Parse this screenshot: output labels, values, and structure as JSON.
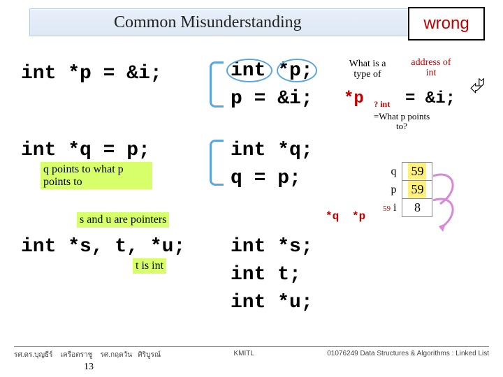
{
  "title": "Common Misunderstanding",
  "wrong_label": "wrong",
  "left": {
    "l1": "int *p = &i;",
    "l2": "int *q = p;",
    "l3": "int *s, t, *u;"
  },
  "right": {
    "r1a": "int *p;",
    "r1b": "p = &i;",
    "r2a": "int *q;",
    "r2b": "q = p;",
    "r3a": "int *s;",
    "r3b": "int t;",
    "r3c": "int *u;"
  },
  "notes": {
    "q_points": "q points to what p points to",
    "su_ptr": "s and u are pointers",
    "t_int": "t is int",
    "what_type": "What is a type of",
    "addr_int": "address of int",
    "star_p": "*p",
    "p_sub": "? int",
    "eq_amp_i": "= &i;",
    "what_p_points": "=What p points to?",
    "star_q": "*q",
    "star_p2": "*p"
  },
  "mouse_icon": "⮰",
  "table": {
    "rows": [
      {
        "label": "q",
        "value": "59"
      },
      {
        "label": "p",
        "value": "59"
      },
      {
        "label": "i",
        "value": "8"
      }
    ],
    "row_addr": "59"
  },
  "footer": {
    "left1": "รศ.ดร.บุญธีร์",
    "left2": "เครือตราชู",
    "left3": "รศ.กฤตวัน",
    "left4": "ศิริบูรณ์",
    "mid": "KMITL",
    "right": "01076249 Data Structures & Algorithms  : Linked List"
  },
  "slide_number": "13"
}
